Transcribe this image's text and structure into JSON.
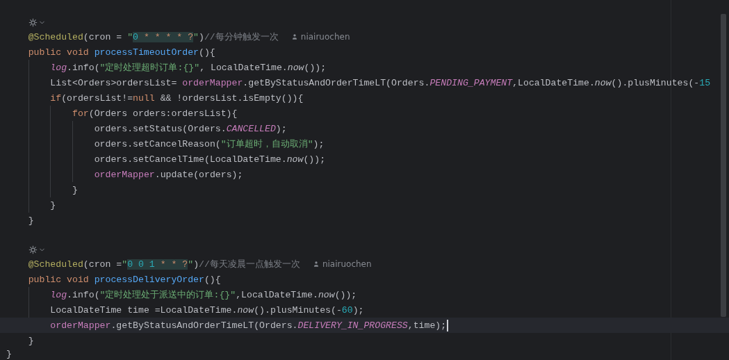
{
  "editor": {
    "lines": [
      {
        "kind": "group",
        "children": [
          {
            "kind": "hint"
          },
          {
            "kind": "code",
            "author": "niairuochen",
            "tokens": [
              {
                "kind": "ann",
                "text": "@Scheduled"
              },
              {
                "kind": "plain",
                "text": "(cron = "
              },
              {
                "kind": "str",
                "text": "\""
              },
              {
                "kind": "cron_num",
                "text": "0"
              },
              {
                "kind": "cron_sym",
                "text": " * * * * ?"
              },
              {
                "kind": "str",
                "text": "\""
              },
              {
                "kind": "plain",
                "text": ")"
              },
              {
                "kind": "cmt",
                "text": "//每分钟触发一次"
              }
            ]
          },
          {
            "kind": "code",
            "tokens": [
              {
                "kind": "kw",
                "text": "public void "
              },
              {
                "kind": "decl",
                "text": "processTimeoutOrder"
              },
              {
                "kind": "plain",
                "text": "(){"
              }
            ],
            "children": [
              {
                "kind": "code",
                "tokens": [
                  {
                    "kind": "const",
                    "text": "log"
                  },
                  {
                    "kind": "plain",
                    "text": ".info("
                  },
                  {
                    "kind": "str",
                    "text": "\"定时处理超时订单:{}\""
                  },
                  {
                    "kind": "plain",
                    "text": ", LocalDateTime."
                  },
                  {
                    "kind": "italic",
                    "text": "now"
                  },
                  {
                    "kind": "plain",
                    "text": "());"
                  }
                ]
              },
              {
                "kind": "code",
                "tokens": [
                  {
                    "kind": "plain",
                    "text": "List<Orders>ordersList= "
                  },
                  {
                    "kind": "field",
                    "text": "orderMapper"
                  },
                  {
                    "kind": "plain",
                    "text": ".getByStatusAndOrderTimeLT(Orders."
                  },
                  {
                    "kind": "const",
                    "text": "PENDING_PAYMENT"
                  },
                  {
                    "kind": "plain",
                    "text": ",LocalDateTime."
                  },
                  {
                    "kind": "italic",
                    "text": "now"
                  },
                  {
                    "kind": "plain",
                    "text": "().plusMinutes(-"
                  },
                  {
                    "kind": "num",
                    "text": "15"
                  }
                ]
              },
              {
                "kind": "code",
                "tokens": [
                  {
                    "kind": "kw",
                    "text": "if"
                  },
                  {
                    "kind": "plain",
                    "text": "(ordersList!="
                  },
                  {
                    "kind": "kw",
                    "text": "null"
                  },
                  {
                    "kind": "plain",
                    "text": " && !ordersList.isEmpty()){"
                  }
                ],
                "children": [
                  {
                    "kind": "code",
                    "tokens": [
                      {
                        "kind": "kw",
                        "text": "for"
                      },
                      {
                        "kind": "plain",
                        "text": "(Orders orders:ordersList){"
                      }
                    ],
                    "children": [
                      {
                        "kind": "code",
                        "tokens": [
                          {
                            "kind": "plain",
                            "text": "orders.setStatus(Orders."
                          },
                          {
                            "kind": "const",
                            "text": "CANCELLED"
                          },
                          {
                            "kind": "plain",
                            "text": ");"
                          }
                        ]
                      },
                      {
                        "kind": "code",
                        "tokens": [
                          {
                            "kind": "plain",
                            "text": "orders.setCancelReason("
                          },
                          {
                            "kind": "str",
                            "text": "\"订单超时，自动取消\""
                          },
                          {
                            "kind": "plain",
                            "text": ");"
                          }
                        ]
                      },
                      {
                        "kind": "code",
                        "tokens": [
                          {
                            "kind": "plain",
                            "text": "orders.setCancelTime(LocalDateTime."
                          },
                          {
                            "kind": "italic",
                            "text": "now"
                          },
                          {
                            "kind": "plain",
                            "text": "());"
                          }
                        ]
                      },
                      {
                        "kind": "code",
                        "tokens": [
                          {
                            "kind": "field",
                            "text": "orderMapper"
                          },
                          {
                            "kind": "plain",
                            "text": ".update(orders);"
                          }
                        ]
                      }
                    ]
                  },
                  {
                    "kind": "code",
                    "tokens": [
                      {
                        "kind": "plain",
                        "text": "}"
                      }
                    ]
                  }
                ]
              },
              {
                "kind": "code",
                "tokens": [
                  {
                    "kind": "plain",
                    "text": "}"
                  }
                ]
              }
            ]
          },
          {
            "kind": "code",
            "tokens": [
              {
                "kind": "plain",
                "text": "}"
              }
            ]
          },
          {
            "kind": "blank"
          },
          {
            "kind": "hint"
          },
          {
            "kind": "code",
            "author": "niairuochen",
            "tokens": [
              {
                "kind": "ann",
                "text": "@Scheduled"
              },
              {
                "kind": "plain",
                "text": "(cron ="
              },
              {
                "kind": "str",
                "text": "\""
              },
              {
                "kind": "cron_num",
                "text": "0 0 1"
              },
              {
                "kind": "cron_sym",
                "text": " * * ?"
              },
              {
                "kind": "str",
                "text": "\""
              },
              {
                "kind": "plain",
                "text": ")"
              },
              {
                "kind": "cmt",
                "text": "//每天凌晨一点触发一次"
              }
            ]
          },
          {
            "kind": "code",
            "tokens": [
              {
                "kind": "kw",
                "text": "public void "
              },
              {
                "kind": "decl",
                "text": "processDeliveryOrder"
              },
              {
                "kind": "plain",
                "text": "(){"
              }
            ],
            "children": [
              {
                "kind": "code",
                "tokens": [
                  {
                    "kind": "const",
                    "text": "log"
                  },
                  {
                    "kind": "plain",
                    "text": ".info("
                  },
                  {
                    "kind": "str",
                    "text": "\"定时处理处于派送中的订单:{}\""
                  },
                  {
                    "kind": "plain",
                    "text": ",LocalDateTime."
                  },
                  {
                    "kind": "italic",
                    "text": "now"
                  },
                  {
                    "kind": "plain",
                    "text": "());"
                  }
                ]
              },
              {
                "kind": "code",
                "tokens": [
                  {
                    "kind": "plain",
                    "text": "LocalDateTime time =LocalDateTime."
                  },
                  {
                    "kind": "italic",
                    "text": "now"
                  },
                  {
                    "kind": "plain",
                    "text": "().plusMinutes(-"
                  },
                  {
                    "kind": "num",
                    "text": "60"
                  },
                  {
                    "kind": "plain",
                    "text": ");"
                  }
                ]
              },
              {
                "kind": "code",
                "current": true,
                "tokens": [
                  {
                    "kind": "field",
                    "text": "orderMapper"
                  },
                  {
                    "kind": "plain",
                    "text": ".getByStatusAndOrderTimeLT(Orders."
                  },
                  {
                    "kind": "const",
                    "text": "DELIVERY_IN_PROGRESS"
                  },
                  {
                    "kind": "plain",
                    "text": ",time);"
                  }
                ]
              }
            ]
          },
          {
            "kind": "code",
            "tokens": [
              {
                "kind": "plain",
                "text": "}"
              }
            ]
          }
        ]
      },
      {
        "kind": "code",
        "tokens": [
          {
            "kind": "plain",
            "text": "}"
          }
        ]
      }
    ]
  }
}
